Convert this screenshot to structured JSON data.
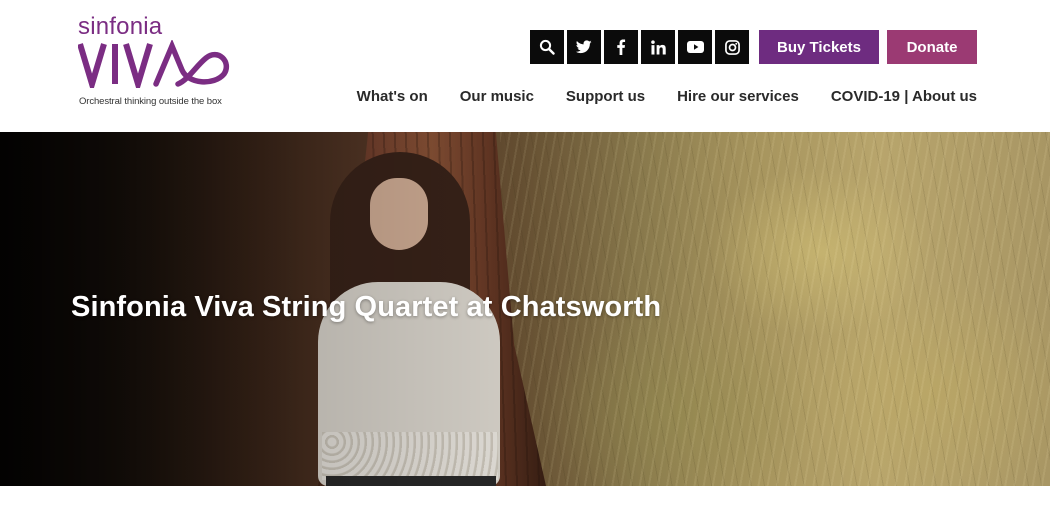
{
  "brand": {
    "name_top": "sinfonia",
    "name_main": "VIVA",
    "tagline": "Orchestral thinking outside the box",
    "color": "#7b2d83"
  },
  "social": [
    {
      "icon": "search-icon",
      "label": "Search"
    },
    {
      "icon": "twitter-icon",
      "label": "Twitter"
    },
    {
      "icon": "facebook-icon",
      "label": "Facebook"
    },
    {
      "icon": "linkedin-icon",
      "label": "LinkedIn"
    },
    {
      "icon": "youtube-icon",
      "label": "YouTube"
    },
    {
      "icon": "instagram-icon",
      "label": "Instagram"
    }
  ],
  "buttons": {
    "tickets": {
      "label": "Buy Tickets",
      "color": "#6e2c80"
    },
    "donate": {
      "label": "Donate",
      "color": "#9b3a73"
    }
  },
  "nav": {
    "items": [
      {
        "label": "What's on"
      },
      {
        "label": "Our music"
      },
      {
        "label": "Support us"
      },
      {
        "label": "Hire our services"
      },
      {
        "label": "COVID-19 | About us"
      }
    ]
  },
  "hero": {
    "title": "Sinfonia Viva String Quartet at Chatsworth"
  }
}
